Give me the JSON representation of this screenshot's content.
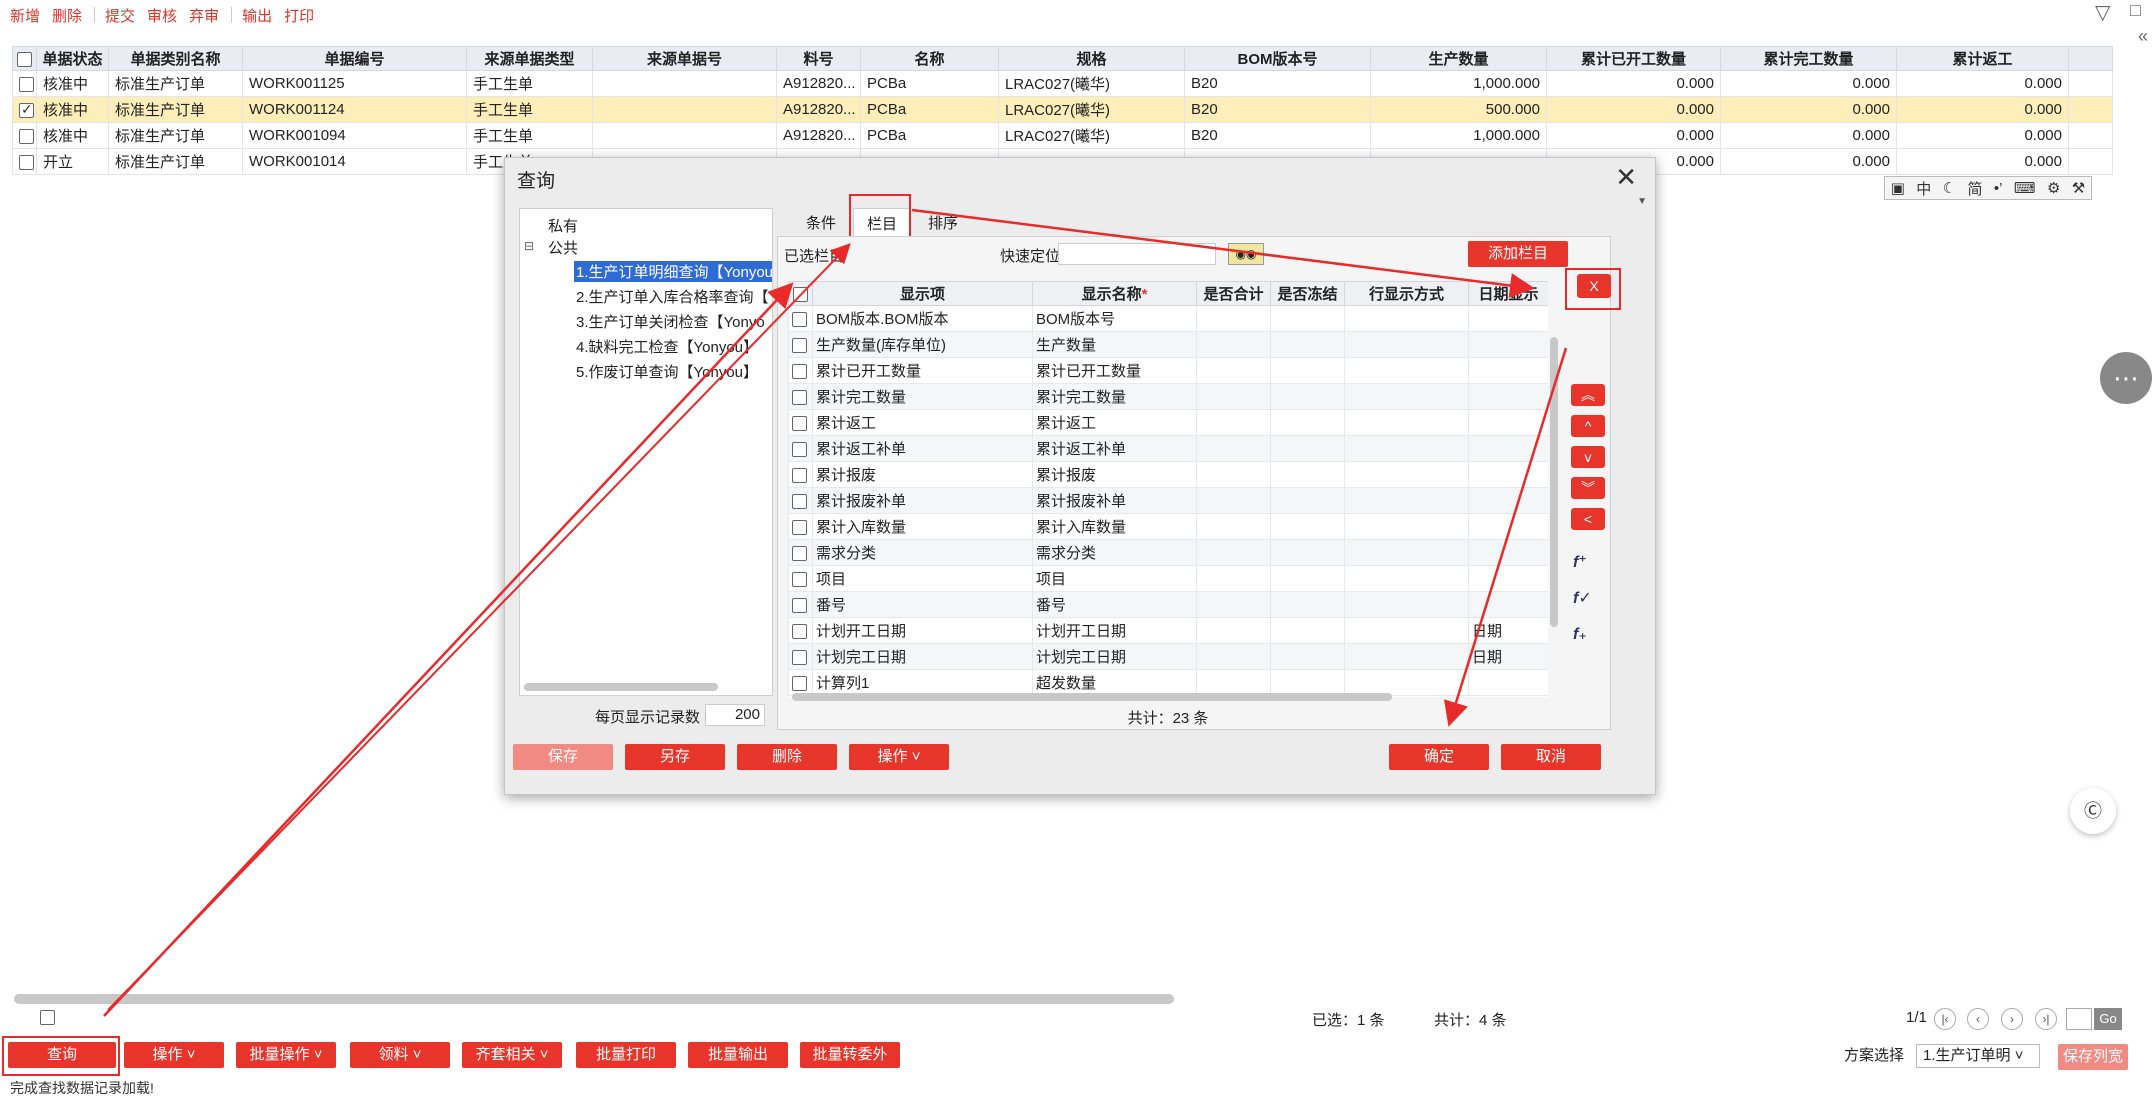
{
  "toolbar": {
    "items": [
      "新增",
      "删除",
      "提交",
      "审核",
      "弃审",
      "输出",
      "打印"
    ]
  },
  "grid": {
    "headers": [
      "单据状态",
      "单据类别名称",
      "单据编号",
      "来源单据类型",
      "来源单据号",
      "料号",
      "名称",
      "规格",
      "BOM版本号",
      "生产数量",
      "累计已开工数量",
      "累计完工数量",
      "累计返工"
    ],
    "rows": [
      {
        "checked": false,
        "status": "核准中",
        "category": "标准生产订单",
        "code": "WORK001125",
        "src_type": "手工生单",
        "src_no": "",
        "part": "A912820...",
        "name": "PCBa",
        "spec": "LRAC027(曦华)",
        "bom": "B20",
        "qty": "1,000.000",
        "started": "0.000",
        "done": "0.000",
        "rework": "0.000"
      },
      {
        "checked": true,
        "status": "核准中",
        "category": "标准生产订单",
        "code": "WORK001124",
        "src_type": "手工生单",
        "src_no": "",
        "part": "A912820...",
        "name": "PCBa",
        "spec": "LRAC027(曦华)",
        "bom": "B20",
        "qty": "500.000",
        "started": "0.000",
        "done": "0.000",
        "rework": "0.000"
      },
      {
        "checked": false,
        "status": "核准中",
        "category": "标准生产订单",
        "code": "WORK001094",
        "src_type": "手工生单",
        "src_no": "",
        "part": "A912820...",
        "name": "PCBa",
        "spec": "LRAC027(曦华)",
        "bom": "B20",
        "qty": "1,000.000",
        "started": "0.000",
        "done": "0.000",
        "rework": "0.000"
      },
      {
        "checked": false,
        "status": "开立",
        "category": "标准生产订单",
        "code": "WORK001014",
        "src_type": "手工生单",
        "src_no": "",
        "part": "",
        "name": "",
        "spec": "",
        "bom": "",
        "qty": "",
        "started": "0.000",
        "done": "0.000",
        "rework": "0.000"
      }
    ]
  },
  "ime_bar": [
    "中",
    "简"
  ],
  "status": {
    "selected": "已选：1 条",
    "total": "共计：4 条",
    "page": "1/1",
    "go": "Go"
  },
  "bottom_buttons": [
    "查询",
    "操作",
    "批量操作",
    "领料",
    "齐套相关",
    "批量打印",
    "批量输出",
    "批量转委外"
  ],
  "scheme": {
    "label": "方案选择",
    "value": "1.生产订单明",
    "save_label": "保存列宽"
  },
  "bottom_msg": "完成查找数据记录加载!",
  "dialog": {
    "title": "查询",
    "tree": {
      "private": "私有",
      "public": "公共",
      "items": [
        "1.生产订单明细查询【Yonyou",
        "2.生产订单入库合格率查询【",
        "3.生产订单关闭检查【Yonyo",
        "4.缺料完工检查【Yonyou】",
        "5.作废订单查询【Yonyou】"
      ]
    },
    "perpage_label": "每页显示记录数",
    "perpage_value": "200",
    "tabs": [
      "条件",
      "栏目",
      "排序"
    ],
    "selected_cols_label": "已选栏目",
    "quick_locate_label": "快速定位",
    "add_column_label": "添加栏目",
    "x_label": "X",
    "col_headers": [
      "显示项",
      "显示名称",
      "是否合计",
      "是否冻结",
      "行显示方式",
      "日期显示"
    ],
    "required_mark": "*",
    "col_rows": [
      {
        "item": "BOM版本.BOM版本",
        "name": "BOM版本号",
        "date": ""
      },
      {
        "item": "生产数量(库存单位)",
        "name": "生产数量",
        "date": ""
      },
      {
        "item": "累计已开工数量",
        "name": "累计已开工数量",
        "date": ""
      },
      {
        "item": "累计完工数量",
        "name": "累计完工数量",
        "date": ""
      },
      {
        "item": "累计返工",
        "name": "累计返工",
        "date": ""
      },
      {
        "item": "累计返工补单",
        "name": "累计返工补单",
        "date": ""
      },
      {
        "item": "累计报废",
        "name": "累计报废",
        "date": ""
      },
      {
        "item": "累计报废补单",
        "name": "累计报废补单",
        "date": ""
      },
      {
        "item": "累计入库数量",
        "name": "累计入库数量",
        "date": ""
      },
      {
        "item": "需求分类",
        "name": "需求分类",
        "date": ""
      },
      {
        "item": "项目",
        "name": "项目",
        "date": ""
      },
      {
        "item": "番号",
        "name": "番号",
        "date": ""
      },
      {
        "item": "计划开工日期",
        "name": "计划开工日期",
        "date": "日期"
      },
      {
        "item": "计划完工日期",
        "name": "计划完工日期",
        "date": "日期"
      },
      {
        "item": "计算列1",
        "name": "超发数量",
        "date": ""
      }
    ],
    "count_text": "共计：23 条",
    "side_buttons": [
      "︽",
      "^",
      "v",
      "︾",
      "<"
    ],
    "buttons": {
      "save": "保存",
      "save_as": "另存",
      "delete": "删除",
      "operate": "操作",
      "ok": "确定",
      "cancel": "取消"
    }
  },
  "colors": {
    "accent": "#e8352b",
    "selected_row": "#fdeeba",
    "annotation": "#e82a2a"
  }
}
